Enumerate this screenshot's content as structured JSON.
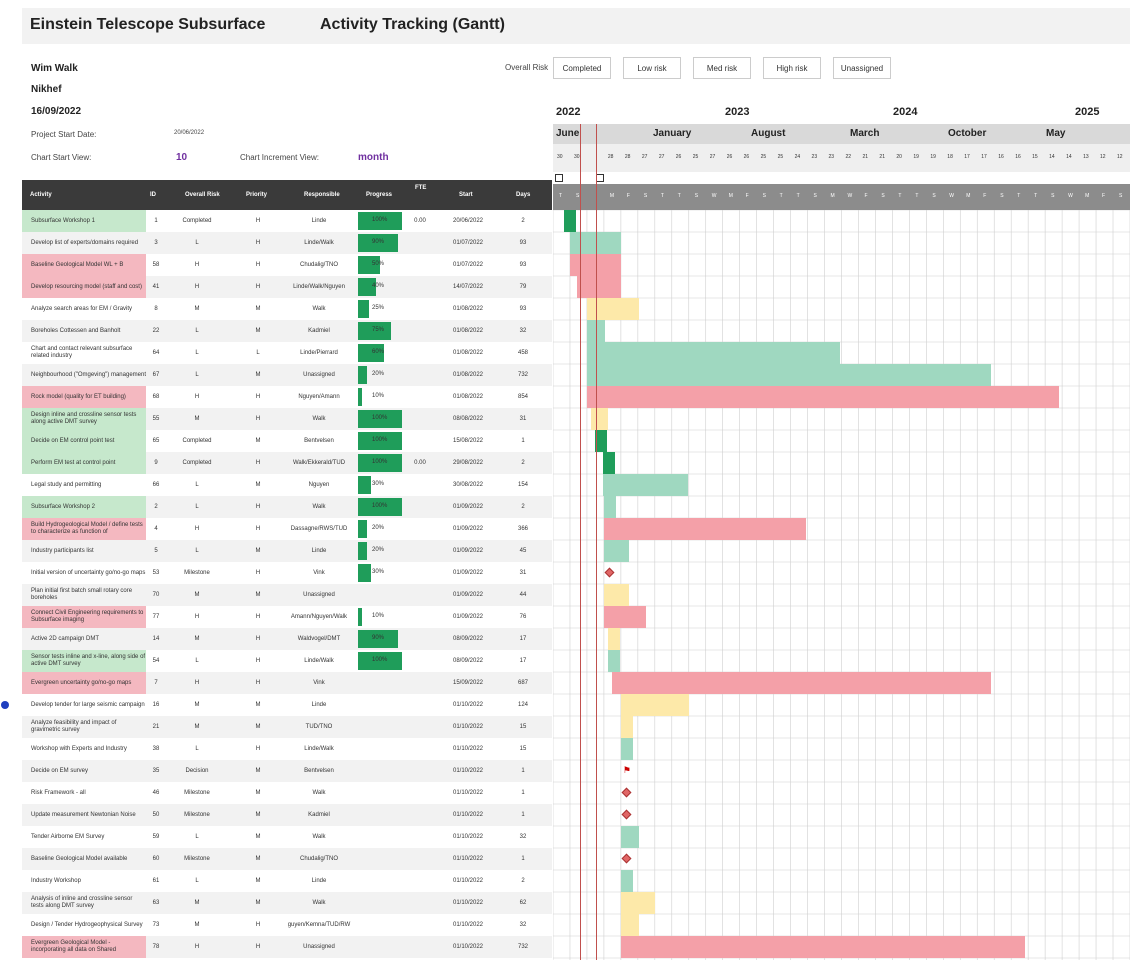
{
  "header": {
    "title_left": "Einstein Telescope Subsurface",
    "title_right": "Activity Tracking (Gantt)"
  },
  "info": {
    "name": "Wim Walk",
    "org": "Nikhef",
    "date": "16/09/2022",
    "project_start_label": "Project Start Date:",
    "project_start_value": "20/06/2022",
    "chart_start_label": "Chart Start View:",
    "chart_start_value": "10",
    "chart_increment_label": "Chart Increment View:",
    "chart_increment_value": "month"
  },
  "legend": {
    "label": "Overall Risk",
    "items": [
      {
        "label": "Completed",
        "color": "#1f9d5a"
      },
      {
        "label": "Low risk",
        "color": "#9fd8c0"
      },
      {
        "label": "Med risk",
        "color": "#fde9a9"
      },
      {
        "label": "High risk",
        "color": "#f4a0a8"
      },
      {
        "label": "Unassigned",
        "color": "#ececec"
      }
    ]
  },
  "timeline": {
    "years": [
      "2022",
      "2023",
      "2024",
      "2025"
    ],
    "months": [
      "June",
      "January",
      "August",
      "March",
      "October",
      "May"
    ],
    "days": [
      "30",
      "30",
      "",
      "28",
      "28",
      "27",
      "27",
      "26",
      "25",
      "27",
      "26",
      "26",
      "25",
      "25",
      "24",
      "23",
      "23",
      "22",
      "21",
      "21",
      "20",
      "19",
      "19",
      "18",
      "17",
      "17",
      "16",
      "16",
      "15",
      "14",
      "14",
      "13",
      "12",
      "12"
    ],
    "weekdays": [
      "T",
      "S",
      "",
      "M",
      "F",
      "S",
      "T",
      "T",
      "S",
      "W",
      "M",
      "F",
      "S",
      "T",
      "T",
      "S",
      "M",
      "W",
      "F",
      "S",
      "T",
      "T",
      "S",
      "W",
      "M",
      "F",
      "S",
      "T",
      "T",
      "S",
      "W",
      "M",
      "F",
      "S"
    ]
  },
  "table": {
    "columns": [
      "Activity",
      "ID",
      "Overall Risk",
      "Priority",
      "Responsible",
      "Progress",
      "FTE",
      "Start",
      "Days"
    ],
    "rows": [
      {
        "activity": "Subsurface Workshop 1",
        "id": "1",
        "risk": "Completed",
        "priority": "H",
        "resp": "Linde",
        "progress": 100,
        "fte": "0.00",
        "start": "20/06/2022",
        "days": "2",
        "hl": "g"
      },
      {
        "activity": "Develop list of experts/domains required",
        "id": "3",
        "risk": "L",
        "priority": "H",
        "resp": "Linde/Walk",
        "progress": 90,
        "fte": "",
        "start": "01/07/2022",
        "days": "93",
        "hl": ""
      },
      {
        "activity": "Baseline Geological Model WL + B",
        "id": "58",
        "risk": "H",
        "priority": "H",
        "resp": "Chudalig/TNO",
        "progress": 50,
        "fte": "",
        "start": "01/07/2022",
        "days": "93",
        "hl": "r"
      },
      {
        "activity": "Develop resourcing model (staff and cost)",
        "id": "41",
        "risk": "H",
        "priority": "H",
        "resp": "Linde/Walk/Nguyen",
        "progress": 40,
        "fte": "",
        "start": "14/07/2022",
        "days": "79",
        "hl": "r"
      },
      {
        "activity": "Analyze search areas for EM / Gravity",
        "id": "8",
        "risk": "M",
        "priority": "M",
        "resp": "Walk",
        "progress": 25,
        "fte": "",
        "start": "01/08/2022",
        "days": "93",
        "hl": ""
      },
      {
        "activity": "Boreholes Cottessen and Banholt",
        "id": "22",
        "risk": "L",
        "priority": "M",
        "resp": "Kadmiel",
        "progress": 75,
        "fte": "",
        "start": "01/08/2022",
        "days": "32",
        "hl": ""
      },
      {
        "activity": "Chart and contact relevant subsurface related industry",
        "id": "64",
        "risk": "L",
        "priority": "L",
        "resp": "Linde/Pierrard",
        "progress": 60,
        "fte": "",
        "start": "01/08/2022",
        "days": "458",
        "hl": ""
      },
      {
        "activity": "Neighbourhood (\"Omgeving\") management",
        "id": "67",
        "risk": "L",
        "priority": "M",
        "resp": "Unassigned",
        "progress": 20,
        "fte": "",
        "start": "01/08/2022",
        "days": "732",
        "hl": ""
      },
      {
        "activity": "Rock model (quality for ET building)",
        "id": "68",
        "risk": "H",
        "priority": "H",
        "resp": "Nguyen/Amann",
        "progress": 10,
        "fte": "",
        "start": "01/08/2022",
        "days": "854",
        "hl": "r"
      },
      {
        "activity": "Design inline and crossline sensor tests along active DMT survey",
        "id": "55",
        "risk": "M",
        "priority": "H",
        "resp": "Walk",
        "progress": 100,
        "fte": "",
        "start": "08/08/2022",
        "days": "31",
        "hl": "g"
      },
      {
        "activity": "Decide on EM control point test",
        "id": "65",
        "risk": "Completed",
        "priority": "M",
        "resp": "Bentvelsen",
        "progress": 100,
        "fte": "",
        "start": "15/08/2022",
        "days": "1",
        "hl": "g"
      },
      {
        "activity": "Perform EM test at control point",
        "id": "9",
        "risk": "Completed",
        "priority": "H",
        "resp": "Walk/Ekkerald/TUD",
        "progress": 100,
        "fte": "0.00",
        "start": "29/08/2022",
        "days": "2",
        "hl": "g"
      },
      {
        "activity": "Legal study and permitting",
        "id": "66",
        "risk": "L",
        "priority": "M",
        "resp": "Nguyen",
        "progress": 30,
        "fte": "",
        "start": "30/08/2022",
        "days": "154",
        "hl": ""
      },
      {
        "activity": "Subsurface Workshop 2",
        "id": "2",
        "risk": "L",
        "priority": "H",
        "resp": "Walk",
        "progress": 100,
        "fte": "",
        "start": "01/09/2022",
        "days": "2",
        "hl": "g"
      },
      {
        "activity": "Build Hydrogeological Model / define tests to characterize as function of",
        "id": "4",
        "risk": "H",
        "priority": "H",
        "resp": "Dassagne/RWS/TUD",
        "progress": 20,
        "fte": "",
        "start": "01/09/2022",
        "days": "366",
        "hl": "r"
      },
      {
        "activity": "Industry participants list",
        "id": "5",
        "risk": "L",
        "priority": "M",
        "resp": "Linde",
        "progress": 20,
        "fte": "",
        "start": "01/09/2022",
        "days": "45",
        "hl": ""
      },
      {
        "activity": "Initial version of uncertainty go/no-go maps",
        "id": "53",
        "risk": "Milestone",
        "priority": "H",
        "resp": "Vink",
        "progress": 30,
        "fte": "",
        "start": "01/09/2022",
        "days": "31",
        "hl": ""
      },
      {
        "activity": "Plan initial first batch small rotary core boreholes",
        "id": "70",
        "risk": "M",
        "priority": "M",
        "resp": "Unassigned",
        "progress": 0,
        "fte": "",
        "start": "01/09/2022",
        "days": "44",
        "hl": ""
      },
      {
        "activity": "Connect Civil Engineering requirements to Subsurface imaging",
        "id": "77",
        "risk": "H",
        "priority": "H",
        "resp": "Amann/Nguyen/Walk",
        "progress": 10,
        "fte": "",
        "start": "01/09/2022",
        "days": "76",
        "hl": "r"
      },
      {
        "activity": "Active 2D campaign DMT",
        "id": "14",
        "risk": "M",
        "priority": "H",
        "resp": "Waldvogel/DMT",
        "progress": 90,
        "fte": "",
        "start": "08/09/2022",
        "days": "17",
        "hl": ""
      },
      {
        "activity": "Sensor tests inline and x-line, along side of active DMT survey",
        "id": "54",
        "risk": "L",
        "priority": "H",
        "resp": "Linde/Walk",
        "progress": 100,
        "fte": "",
        "start": "08/09/2022",
        "days": "17",
        "hl": "g"
      },
      {
        "activity": "Evergreen uncertainty go/no-go maps",
        "id": "7",
        "risk": "H",
        "priority": "H",
        "resp": "Vink",
        "progress": 0,
        "fte": "",
        "start": "15/09/2022",
        "days": "687",
        "hl": "r"
      },
      {
        "activity": "Develop tender for large seismic campaign",
        "id": "16",
        "risk": "M",
        "priority": "M",
        "resp": "Linde",
        "progress": 0,
        "fte": "",
        "start": "01/10/2022",
        "days": "124",
        "hl": ""
      },
      {
        "activity": "Analyze feasibility and impact of gravimetric survey",
        "id": "21",
        "risk": "M",
        "priority": "M",
        "resp": "TUD/TNO",
        "progress": 0,
        "fte": "",
        "start": "01/10/2022",
        "days": "15",
        "hl": ""
      },
      {
        "activity": "Workshop with Experts and Industry",
        "id": "38",
        "risk": "L",
        "priority": "H",
        "resp": "Linde/Walk",
        "progress": 0,
        "fte": "",
        "start": "01/10/2022",
        "days": "15",
        "hl": ""
      },
      {
        "activity": "Decide on EM survey",
        "id": "35",
        "risk": "Decision",
        "priority": "M",
        "resp": "Bentvelsen",
        "progress": 0,
        "fte": "",
        "start": "01/10/2022",
        "days": "1",
        "hl": ""
      },
      {
        "activity": "Risk Framework - all",
        "id": "46",
        "risk": "Milestone",
        "priority": "M",
        "resp": "Walk",
        "progress": 0,
        "fte": "",
        "start": "01/10/2022",
        "days": "1",
        "hl": ""
      },
      {
        "activity": "Update measurement Newtonian Noise",
        "id": "50",
        "risk": "Milestone",
        "priority": "M",
        "resp": "Kadmiel",
        "progress": 0,
        "fte": "",
        "start": "01/10/2022",
        "days": "1",
        "hl": ""
      },
      {
        "activity": "Tender Airborne EM Survey",
        "id": "59",
        "risk": "L",
        "priority": "M",
        "resp": "Walk",
        "progress": 0,
        "fte": "",
        "start": "01/10/2022",
        "days": "32",
        "hl": ""
      },
      {
        "activity": "Baseline Geological Model available",
        "id": "60",
        "risk": "Milestone",
        "priority": "M",
        "resp": "Chudalig/TNO",
        "progress": 0,
        "fte": "",
        "start": "01/10/2022",
        "days": "1",
        "hl": ""
      },
      {
        "activity": "Industry Workshop",
        "id": "61",
        "risk": "L",
        "priority": "M",
        "resp": "Linde",
        "progress": 0,
        "fte": "",
        "start": "01/10/2022",
        "days": "2",
        "hl": ""
      },
      {
        "activity": "Analysis of inline and crossline sensor tests along DMT survey",
        "id": "63",
        "risk": "M",
        "priority": "M",
        "resp": "Walk",
        "progress": 0,
        "fte": "",
        "start": "01/10/2022",
        "days": "62",
        "hl": ""
      },
      {
        "activity": "Design / Tender Hydrogeophysical Survey",
        "id": "73",
        "risk": "M",
        "priority": "H",
        "resp": "guyen/Kemna/TUD/RW",
        "progress": 0,
        "fte": "",
        "start": "01/10/2022",
        "days": "32",
        "hl": ""
      },
      {
        "activity": "Evergreen Geological Model - incorporating all data on Shared",
        "id": "78",
        "risk": "H",
        "priority": "H",
        "resp": "Unassigned",
        "progress": 0,
        "fte": "",
        "start": "01/10/2022",
        "days": "732",
        "hl": "r"
      }
    ]
  },
  "gantt": [
    {
      "type": "bar",
      "start": "2022-06-20",
      "days": 2,
      "color": "#1f9d5a"
    },
    {
      "type": "bar",
      "start": "2022-07-01",
      "days": 93,
      "color": "#9fd8c0"
    },
    {
      "type": "bar",
      "start": "2022-07-01",
      "days": 93,
      "color": "#f4a0a8"
    },
    {
      "type": "bar",
      "start": "2022-07-14",
      "days": 79,
      "color": "#f4a0a8"
    },
    {
      "type": "bar",
      "start": "2022-08-01",
      "days": 93,
      "color": "#fde9a9"
    },
    {
      "type": "bar",
      "start": "2022-08-01",
      "days": 32,
      "color": "#9fd8c0"
    },
    {
      "type": "bar",
      "start": "2022-08-01",
      "days": 458,
      "color": "#9fd8c0"
    },
    {
      "type": "bar",
      "start": "2022-08-01",
      "days": 732,
      "color": "#9fd8c0"
    },
    {
      "type": "bar",
      "start": "2022-08-01",
      "days": 854,
      "color": "#f4a0a8"
    },
    {
      "type": "bar",
      "start": "2022-08-08",
      "days": 31,
      "color": "#fde9a9"
    },
    {
      "type": "bar",
      "start": "2022-08-15",
      "days": 1,
      "color": "#1f9d5a"
    },
    {
      "type": "bar",
      "start": "2022-08-29",
      "days": 2,
      "color": "#1f9d5a"
    },
    {
      "type": "bar",
      "start": "2022-08-30",
      "days": 154,
      "color": "#9fd8c0"
    },
    {
      "type": "bar",
      "start": "2022-09-01",
      "days": 2,
      "color": "#9fd8c0"
    },
    {
      "type": "bar",
      "start": "2022-09-01",
      "days": 366,
      "color": "#f4a0a8"
    },
    {
      "type": "bar",
      "start": "2022-09-01",
      "days": 45,
      "color": "#9fd8c0"
    },
    {
      "type": "milestone",
      "start": "2022-09-01"
    },
    {
      "type": "bar",
      "start": "2022-09-01",
      "days": 44,
      "color": "#fde9a9"
    },
    {
      "type": "bar",
      "start": "2022-09-01",
      "days": 76,
      "color": "#f4a0a8"
    },
    {
      "type": "bar",
      "start": "2022-09-08",
      "days": 17,
      "color": "#fde9a9"
    },
    {
      "type": "bar",
      "start": "2022-09-08",
      "days": 17,
      "color": "#9fd8c0"
    },
    {
      "type": "bar",
      "start": "2022-09-15",
      "days": 687,
      "color": "#f4a0a8"
    },
    {
      "type": "bar",
      "start": "2022-10-01",
      "days": 124,
      "color": "#fde9a9"
    },
    {
      "type": "bar",
      "start": "2022-10-01",
      "days": 15,
      "color": "#fde9a9"
    },
    {
      "type": "bar",
      "start": "2022-10-01",
      "days": 15,
      "color": "#9fd8c0"
    },
    {
      "type": "flag",
      "start": "2022-10-01"
    },
    {
      "type": "milestone",
      "start": "2022-10-01"
    },
    {
      "type": "milestone",
      "start": "2022-10-01"
    },
    {
      "type": "bar",
      "start": "2022-10-01",
      "days": 32,
      "color": "#9fd8c0"
    },
    {
      "type": "milestone",
      "start": "2022-10-01"
    },
    {
      "type": "bar",
      "start": "2022-10-01",
      "days": 2,
      "color": "#9fd8c0"
    },
    {
      "type": "bar",
      "start": "2022-10-01",
      "days": 62,
      "color": "#fde9a9"
    },
    {
      "type": "bar",
      "start": "2022-10-01",
      "days": 32,
      "color": "#fde9a9"
    },
    {
      "type": "bar",
      "start": "2022-10-01",
      "days": 732,
      "color": "#f4a0a8"
    }
  ]
}
